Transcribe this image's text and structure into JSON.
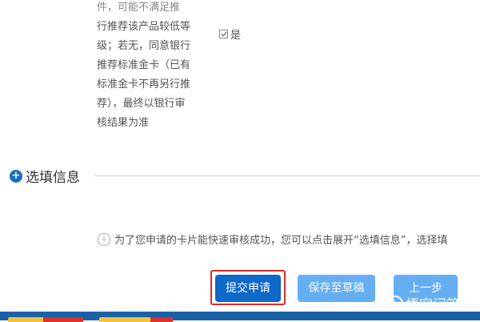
{
  "terms": {
    "lines": [
      "件，可能不满足推",
      "行推荐该产品较低等",
      "级；若无，同意银行",
      "推荐标准金卡（已有",
      "标准金卡不再另行推",
      "荐），最终以银行审",
      "核结果为准"
    ],
    "agree_label": "是"
  },
  "optional_section": {
    "label": "选填信息"
  },
  "notice": {
    "text": "为了您申请的卡片能快速审核成功，您可以点击展开“选填信息”，选择填"
  },
  "actions": {
    "submit": "提交申请",
    "save_draft": "保存至草稿",
    "previous": "上一步"
  },
  "watermark": {
    "text": "悟空问答"
  }
}
